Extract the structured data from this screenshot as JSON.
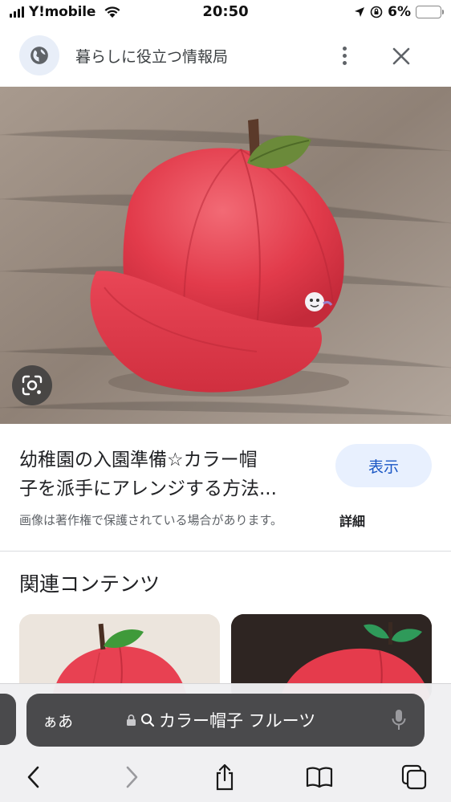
{
  "status_bar": {
    "carrier": "Y!mobile",
    "time": "20:50",
    "battery_percent": "6%",
    "battery_level": 0.06
  },
  "header": {
    "site_name": "暮らしに役立つ情報局"
  },
  "result": {
    "title_line1": "幼稚園の入園準備☆カラー帽",
    "title_line2": "子を派手にアレンジする方法...",
    "show_button": "表示",
    "copyright_notice": "画像は著作権で保護されている場合があります。",
    "details_link": "詳細"
  },
  "related": {
    "heading": "関連コンテンツ"
  },
  "browser": {
    "aa_label": "ぁあ",
    "search_query": "カラー帽子 フルーツ"
  },
  "colors": {
    "accent_blue": "#1a56c4",
    "button_bg": "#e8f0fe",
    "hat_red": "#e8394a",
    "leaf_green": "#6b8a3a"
  }
}
